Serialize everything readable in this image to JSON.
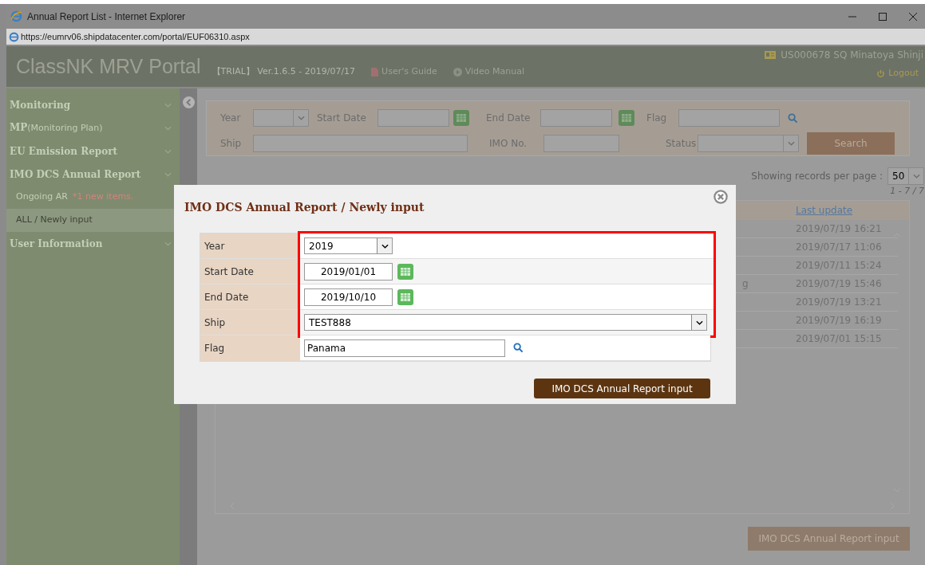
{
  "window": {
    "title": "Annual Report List - Internet Explorer"
  },
  "address_bar": {
    "url": "https://eumrv06.shipdatacenter.com/portal/EUF06310.aspx"
  },
  "header": {
    "app_title": "ClassNK MRV Portal",
    "version": "【TRIAL】 Ver.1.6.5 - 2019/07/17",
    "links": [
      "User's Guide",
      "Video Manual"
    ],
    "user": "US000678 SQ Minatoya Shinji",
    "logout": "Logout"
  },
  "sidebar": {
    "items": [
      {
        "kind": "section",
        "label": "Monitoring"
      },
      {
        "kind": "section",
        "label": "MP",
        "note": "(Monitoring Plan)"
      },
      {
        "kind": "section",
        "label": "EU Emission Report"
      },
      {
        "kind": "section",
        "label": "IMO DCS Annual Report"
      },
      {
        "kind": "subitem",
        "label": "Ongoing AR",
        "alert": "*1 new items.",
        "selected": false
      },
      {
        "kind": "subitem",
        "label": "ALL / Newly input",
        "selected": true
      },
      {
        "kind": "section",
        "label": "User Information"
      }
    ]
  },
  "search": {
    "year_label": "Year",
    "start_label": "Start Date",
    "end_label": "End Date",
    "flag_label": "Flag",
    "ship_label": "Ship",
    "imo_label": "IMO No.",
    "status_label": "Status",
    "button": "Search"
  },
  "list": {
    "per_page_label": "Showing records per page :",
    "per_page": "50",
    "range": "1 - 7 / 7",
    "column_header": "Last update",
    "rows": [
      {
        "last_update": "2019/07/19 16:21"
      },
      {
        "last_update": "2019/07/17 11:06"
      },
      {
        "last_update": "2019/07/11 15:24"
      },
      {
        "column_2": "g",
        "last_update": "2019/07/19 15:46"
      },
      {
        "last_update": "2019/07/19 13:21"
      },
      {
        "last_update": "2019/07/19 16:19"
      },
      {
        "last_update": "2019/07/01 15:15"
      }
    ],
    "button": "IMO DCS Annual Report input"
  },
  "dialog": {
    "title": "IMO DCS Annual Report / Newly input",
    "fields": [
      {
        "kind": "select",
        "label": "Year",
        "value": "2019",
        "highlighted": true
      },
      {
        "kind": "date",
        "label": "Start Date",
        "value": "2019/01/01",
        "highlighted": true
      },
      {
        "kind": "date",
        "label": "End Date",
        "value": "2019/10/10",
        "highlighted": true
      },
      {
        "kind": "wide-select",
        "label": "Ship",
        "value": "TEST888",
        "highlighted": true
      },
      {
        "kind": "lookup",
        "label": "Flag",
        "value": "Panama",
        "highlighted": false
      }
    ],
    "button": "IMO DCS Annual Report input"
  }
}
